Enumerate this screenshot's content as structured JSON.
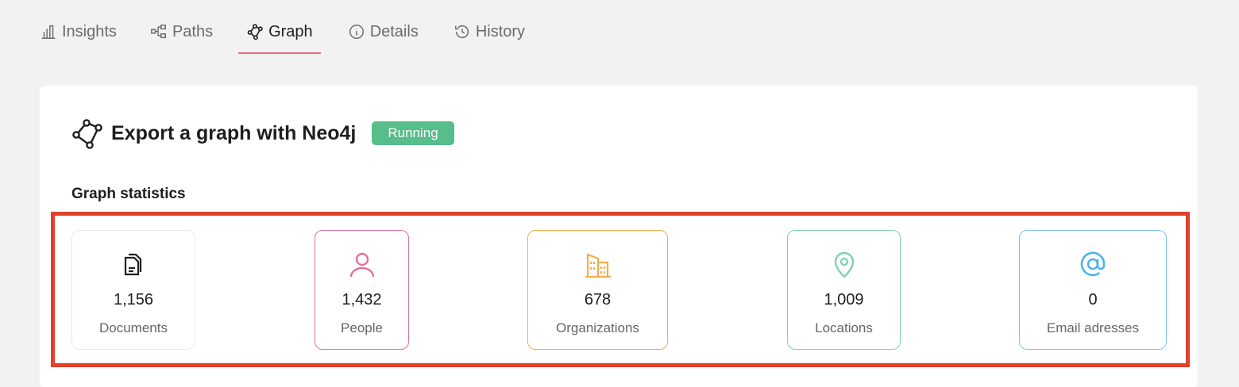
{
  "tabs": [
    {
      "label": "Insights",
      "icon": "bar-chart-icon",
      "active": false
    },
    {
      "label": "Paths",
      "icon": "hierarchy-icon",
      "active": false
    },
    {
      "label": "Graph",
      "icon": "graph-icon",
      "active": true
    },
    {
      "label": "Details",
      "icon": "info-icon",
      "active": false
    },
    {
      "label": "History",
      "icon": "history-icon",
      "active": false
    }
  ],
  "header": {
    "title": "Export a graph with Neo4j",
    "status": "Running",
    "status_color": "#56bd8b"
  },
  "stats": {
    "title": "Graph statistics",
    "items": [
      {
        "value": "1,156",
        "label": "Documents",
        "icon": "documents-icon",
        "color": "#222222"
      },
      {
        "value": "1,432",
        "label": "People",
        "icon": "person-icon",
        "color": "#e2709a"
      },
      {
        "value": "678",
        "label": "Organizations",
        "icon": "building-icon",
        "color": "#f0ad4e"
      },
      {
        "value": "1,009",
        "label": "Locations",
        "icon": "location-pin-icon",
        "color": "#7fd3ad"
      },
      {
        "value": "0",
        "label": "Email adresses",
        "icon": "at-sign-icon",
        "color": "#4fb3ea"
      }
    ]
  },
  "highlight_color": "#e2412a"
}
